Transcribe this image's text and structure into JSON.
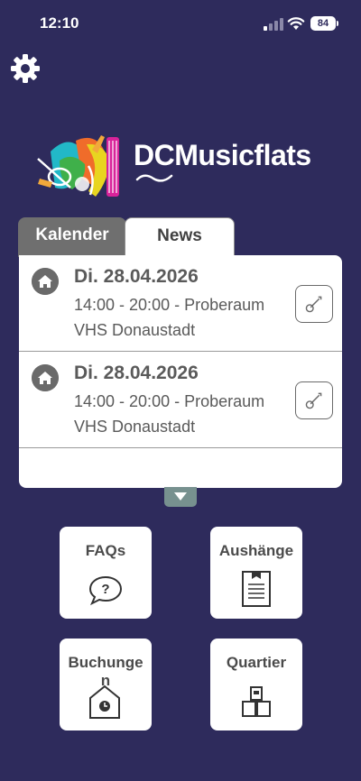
{
  "status_bar": {
    "time": "12:10",
    "battery": "84"
  },
  "logo": {
    "brand_text": "DCMusicflats"
  },
  "tabs": [
    {
      "label": "Kalender",
      "active": true
    },
    {
      "label": "News",
      "active": false
    }
  ],
  "events": [
    {
      "date": "Di. 28.04.2026",
      "time": "14:00 - 20:00 - Proberaum",
      "place": "VHS Donaustadt"
    },
    {
      "date": "Di. 28.04.2026",
      "time": "14:00 - 20:00 - Proberaum",
      "place": "VHS Donaustadt"
    }
  ],
  "tiles": {
    "faqs": {
      "label": "FAQs",
      "icon": "question-bubble-icon"
    },
    "aushaenge": {
      "label": "Aushänge",
      "icon": "notice-board-icon"
    },
    "buchungen": {
      "label": "Buchunge n",
      "icon": "house-clock-icon"
    },
    "quartier": {
      "label": "Quartier",
      "icon": "building-blocks-icon"
    }
  },
  "colors": {
    "background": "#2e2b5c",
    "tab_active": "#6f6f6f",
    "expand_button": "#77918f"
  }
}
